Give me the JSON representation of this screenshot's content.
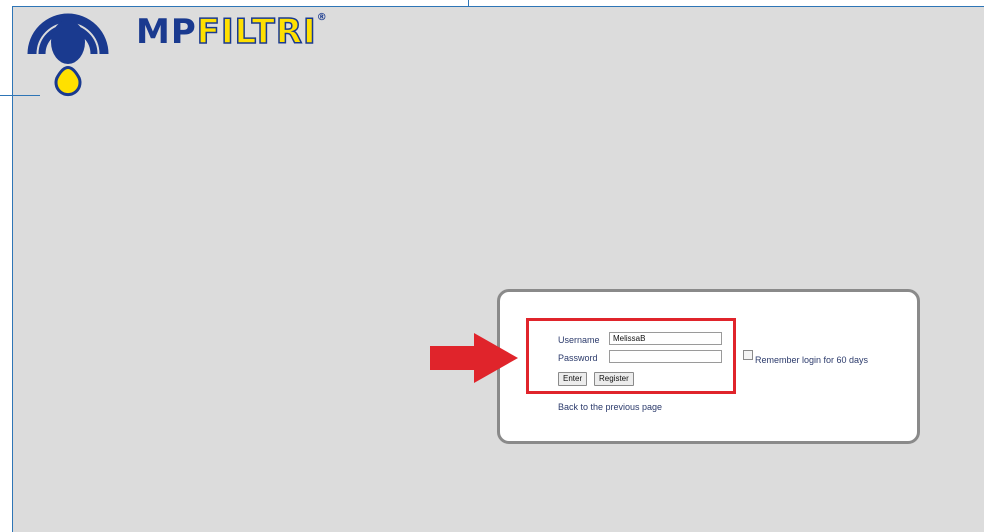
{
  "logo": {
    "text_mp": "MP",
    "text_filtri": "FILTRI",
    "registered": "®"
  },
  "login": {
    "username_label": "Username",
    "username_value": "MelissaB",
    "password_label": "Password",
    "password_value": "",
    "enter_label": "Enter",
    "register_label": "Register",
    "remember_label": "Remember login for 60 days",
    "remember_checked": false,
    "back_link": "Back to the previous page"
  },
  "colors": {
    "highlight": "#e0242b",
    "arrow": "#e0242b",
    "brand_blue": "#1a3a8f",
    "brand_yellow": "#ffe000"
  }
}
